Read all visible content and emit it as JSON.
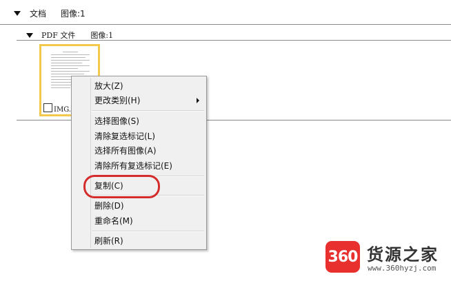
{
  "section1": {
    "label": "文档",
    "count": "图像:1"
  },
  "section2": {
    "label": "PDF 文件",
    "count": "图像:1"
  },
  "thumbnail": {
    "filename": "IMG.p"
  },
  "context_menu": {
    "items": [
      "放大(Z)",
      "更改类别(H)",
      "选择图像(S)",
      "清除复选标记(L)",
      "选择所有图像(A)",
      "清除所有复选标记(E)",
      "复制(C)",
      "删除(D)",
      "重命名(M)",
      "刷新(R)"
    ],
    "highlight_color": "#d42b2b"
  },
  "watermark": {
    "logo": "360",
    "name": "货源之家",
    "url": "www.360hyzj.com",
    "brand_color": "#e8302e"
  }
}
